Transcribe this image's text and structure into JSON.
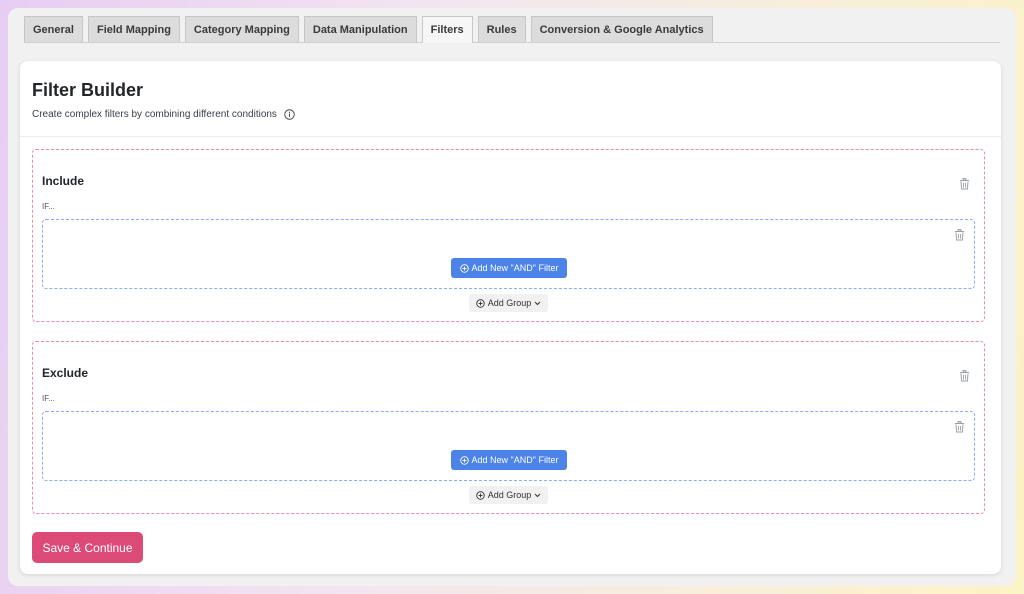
{
  "tabs": [
    {
      "label": "General"
    },
    {
      "label": "Field Mapping"
    },
    {
      "label": "Category Mapping"
    },
    {
      "label": "Data Manipulation"
    },
    {
      "label": "Filters",
      "active": true
    },
    {
      "label": "Rules"
    },
    {
      "label": "Conversion & Google Analytics"
    }
  ],
  "header": {
    "title": "Filter Builder",
    "subtitle": "Create complex filters by combining different conditions",
    "info_icon": "info-circle-icon"
  },
  "include": {
    "title": "Include",
    "if_label": "IF...",
    "and_filter_label": "Add New \"AND\" Filter",
    "add_group_label": "Add Group"
  },
  "exclude": {
    "title": "Exclude",
    "if_label": "IF...",
    "and_filter_label": "Add New \"AND\" Filter",
    "add_group_label": "Add Group"
  },
  "actions": {
    "save_label": "Save & Continue"
  },
  "colors": {
    "primary_button": "#4b83e8",
    "save_button": "#dc4a77",
    "section_border": "#f08aa4",
    "group_border": "#86aef2"
  }
}
